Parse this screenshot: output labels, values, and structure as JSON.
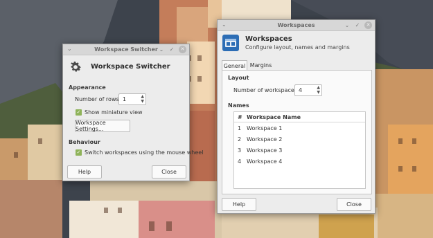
{
  "switcher": {
    "title": "Workspace Switcher",
    "header_title": "Workspace Switcher",
    "appearance_label": "Appearance",
    "rows_label": "Number of rows:",
    "rows_value": "1",
    "miniature_label": "Show miniature view",
    "miniature_checked": true,
    "settings_button": "Workspace Settings...",
    "behaviour_label": "Behaviour",
    "mouse_wheel_label": "Switch workspaces using the mouse wheel",
    "mouse_wheel_checked": true,
    "help_button": "Help",
    "close_button": "Close"
  },
  "workspaces": {
    "title": "Workspaces",
    "header_title": "Workspaces",
    "header_subtitle": "Configure layout, names and margins",
    "tabs": [
      {
        "label": "General",
        "active": true
      },
      {
        "label": "Margins",
        "active": false
      }
    ],
    "layout_label": "Layout",
    "count_label": "Number of workspaces:",
    "count_value": "4",
    "names_label": "Names",
    "columns": [
      "#",
      "Workspace Name"
    ],
    "rows": [
      {
        "num": "1",
        "name": "Workspace 1"
      },
      {
        "num": "2",
        "name": "Workspace 2"
      },
      {
        "num": "3",
        "name": "Workspace 3"
      },
      {
        "num": "4",
        "name": "Workspace 4"
      }
    ],
    "help_button": "Help",
    "close_button": "Close"
  },
  "titlebar_glyphs": {
    "menu": "⌄",
    "minimize": "⌄",
    "maximize": "✓",
    "close": "✕"
  },
  "icons": {
    "switcher_header": "gear-icon",
    "workspaces_header": "workspaces-app-icon"
  },
  "colors": {
    "accent_check": "#8fb35a",
    "app_icon": "#2c6db5"
  }
}
